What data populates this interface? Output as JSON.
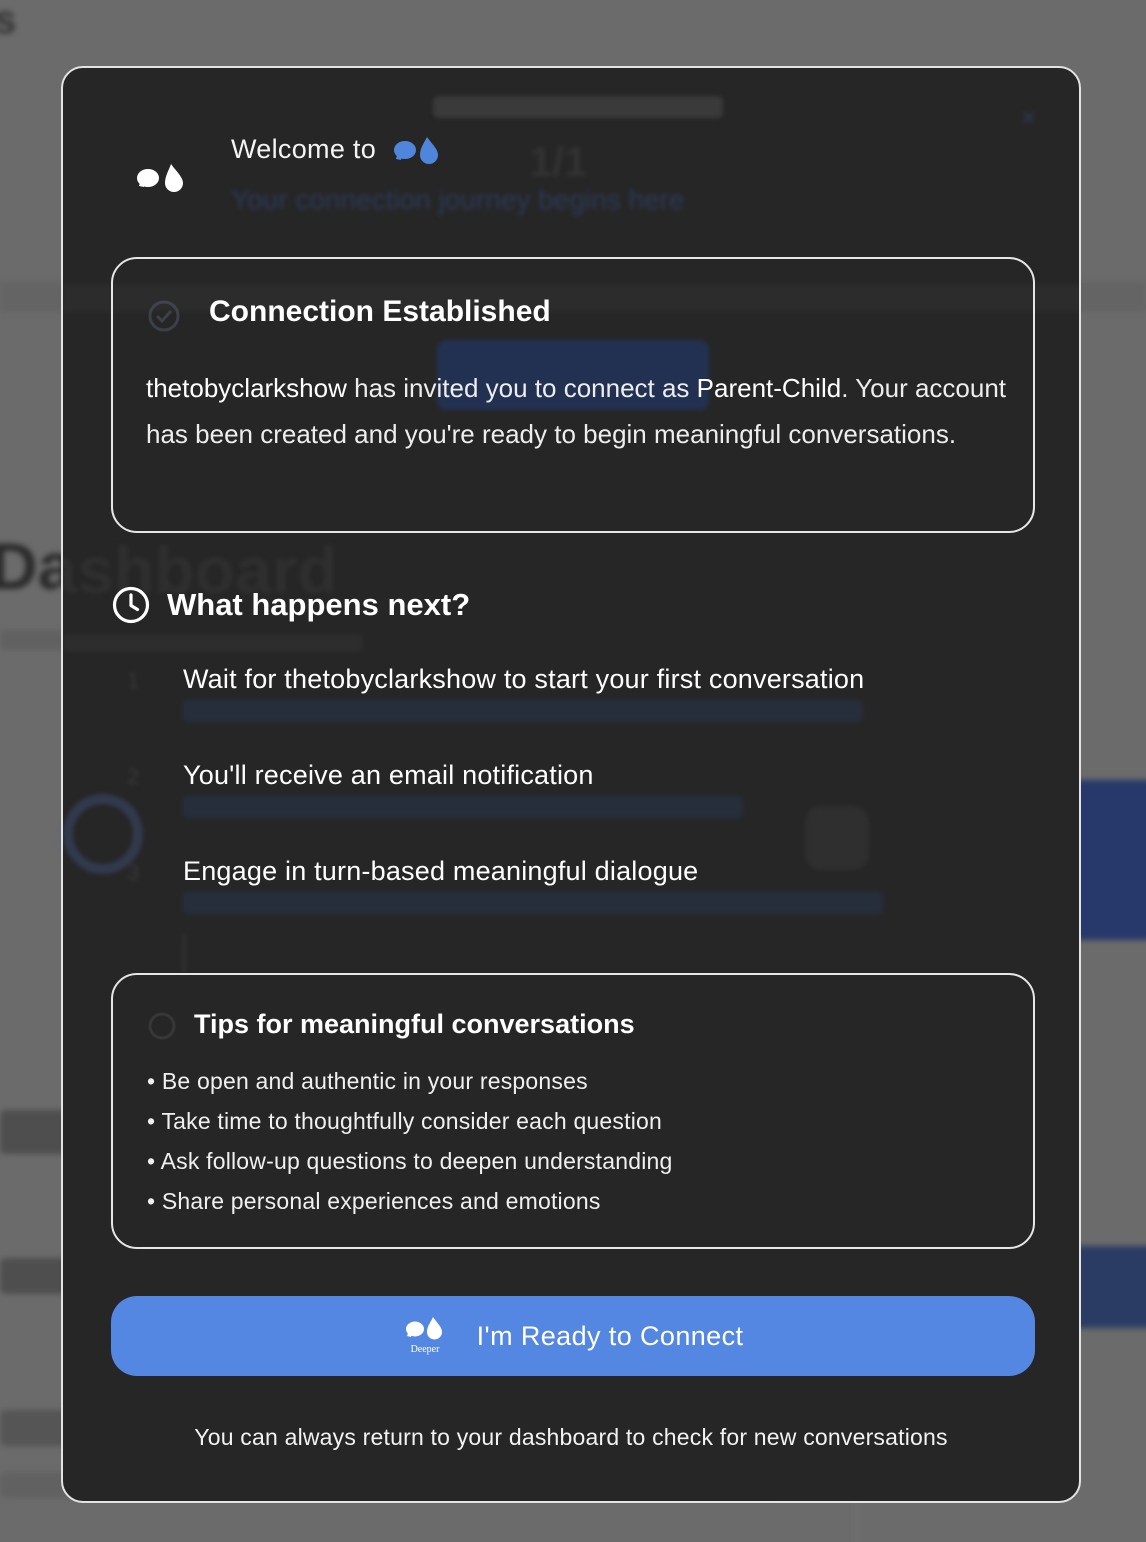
{
  "background": {
    "top_letter": "s",
    "count": "1/1",
    "subtitle": "Your connection journey begins here",
    "close_glyph": "×",
    "page_heading": "Dashboard"
  },
  "modal": {
    "welcome_text": "Welcome to",
    "connection_card": {
      "title": "Connection Established",
      "inviter": "thetobyclarkshow",
      "invite_middle": " has invited you to connect as ",
      "relationship": "Parent-Child",
      "invite_end": ".",
      "body_rest": "Your account has been created and you're ready to begin meaningful conversations."
    },
    "next": {
      "title": "What happens next?",
      "steps": [
        {
          "number": "1",
          "title": "Wait for thetobyclarkshow to start your first conversation"
        },
        {
          "number": "2",
          "title": "You'll receive an email notification"
        },
        {
          "number": "3",
          "title": "Engage in turn-based meaningful dialogue"
        }
      ]
    },
    "tips": {
      "title": "Tips for meaningful conversations",
      "items": [
        "Be open and authentic in your responses",
        "Take time to thoughtfully consider each question",
        "Ask follow-up questions to deepen understanding",
        "Share personal experiences and emotions"
      ]
    },
    "cta": {
      "label": "I'm Ready to Connect",
      "logo_caption": "Deeper"
    },
    "footnote": "You can always return to your dashboard to check for new conversations"
  },
  "icons": {
    "app_logo": "deeper-logo-icon",
    "clock": "clock-icon",
    "check": "check-circle-icon",
    "bulb": "lightbulb-icon"
  },
  "colors": {
    "modal_bg": "#262626",
    "border": "#e6e6e6",
    "accent_blue": "#5487e2",
    "logo_blue": "#4f86dc",
    "overlay": "#6b6b6b"
  }
}
